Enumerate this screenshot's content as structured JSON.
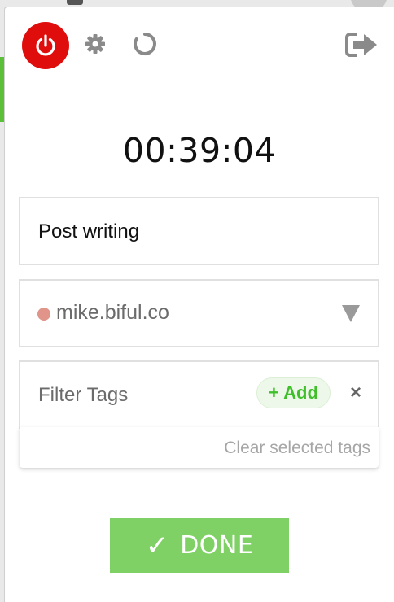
{
  "toolbar": {
    "power_icon": "power-icon",
    "settings_icon": "gear-icon",
    "sync_icon": "refresh-icon",
    "logout_icon": "logout-icon"
  },
  "timer": {
    "elapsed": "00:39:04"
  },
  "entry": {
    "description": "Post writing"
  },
  "project": {
    "name": "mike.biful.co",
    "color": "#e0948a"
  },
  "tags": {
    "placeholder": "Filter Tags",
    "add_label": "+ Add",
    "clear_icon": "×",
    "clear_selected_label": "Clear selected tags"
  },
  "done": {
    "check": "✓",
    "label": "DONE"
  },
  "colors": {
    "power": "#e00d0d",
    "accent_green": "#7fd166",
    "add_green": "#3fbf2a"
  }
}
